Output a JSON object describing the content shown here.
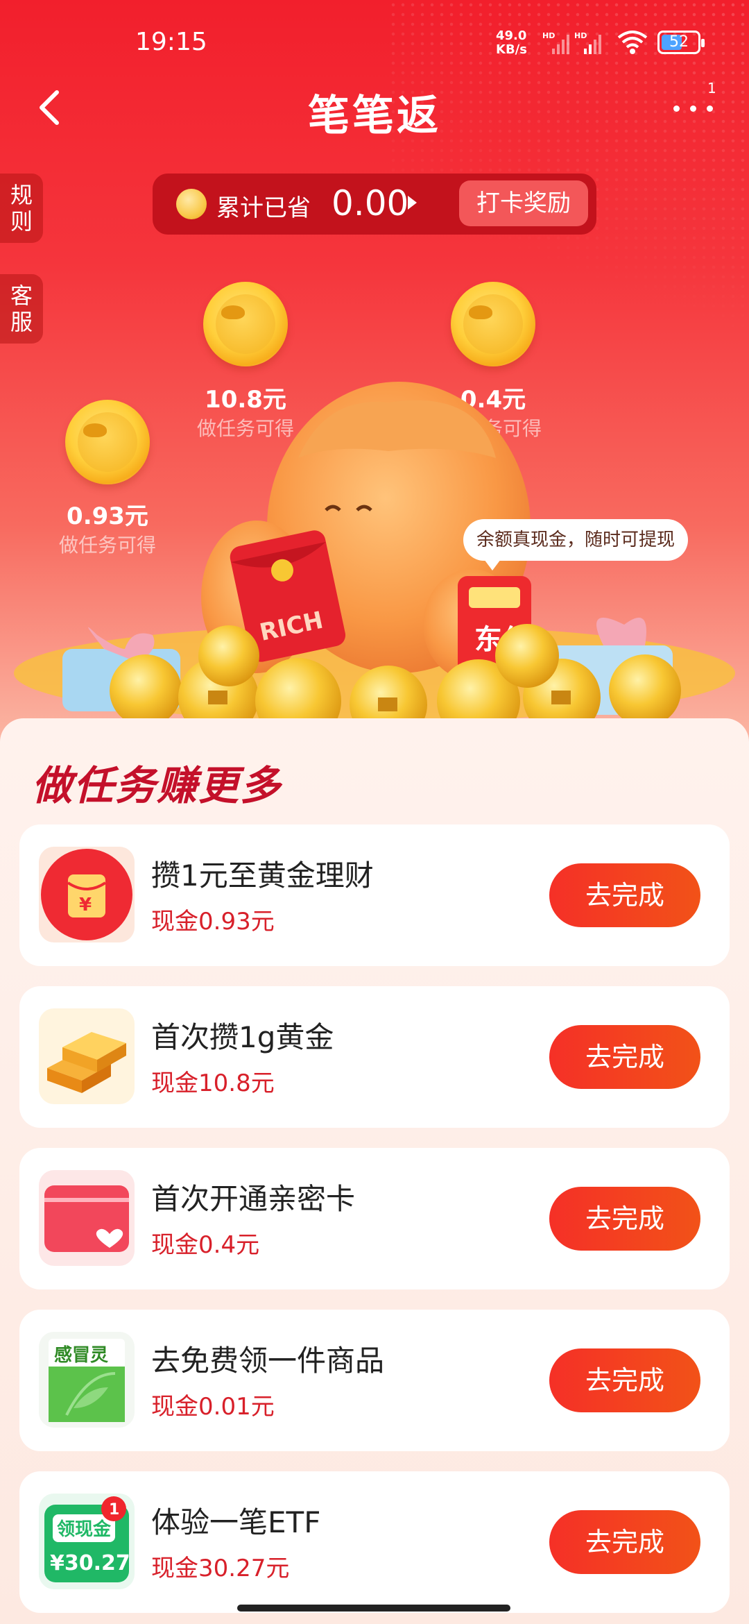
{
  "status_bar": {
    "time": "19:15",
    "speed": "49.0",
    "speed_unit": "KB/s",
    "hd": "HD",
    "battery": "52"
  },
  "nav": {
    "title": "笔笔返",
    "badge": "1"
  },
  "side_tabs": [
    {
      "label": "规\n则"
    },
    {
      "label": "客\n服"
    }
  ],
  "saved": {
    "label": "累计已省",
    "value": "0.00",
    "reward_button": "打卡奖励"
  },
  "coins": [
    {
      "amount": "10.8元",
      "sub": "做任务可得"
    },
    {
      "amount": "0.4元",
      "sub": "做任务可得"
    },
    {
      "amount": "0.93元",
      "sub": "做任务可得"
    }
  ],
  "bubble": "余额真现金，随时可提现",
  "mascot_text": {
    "bag": "RICH",
    "card": "东付"
  },
  "section_title": "做任务赚更多",
  "tasks": [
    {
      "name": "攒1元至黄金理财",
      "reward": "现金0.93元",
      "button": "去完成",
      "icon": "red-envelope-icon"
    },
    {
      "name": "首次攒1g黄金",
      "reward": "现金10.8元",
      "button": "去完成",
      "icon": "gold-bar-icon"
    },
    {
      "name": "首次开通亲密卡",
      "reward": "现金0.4元",
      "button": "去完成",
      "icon": "heart-card-icon"
    },
    {
      "name": "去免费领一件商品",
      "reward": "现金0.01元",
      "button": "去完成",
      "icon": "medicine-box-icon"
    },
    {
      "name": "体验一笔ETF",
      "reward": "现金30.27元",
      "button": "去完成",
      "icon": "cash-coupon-icon"
    }
  ],
  "task_icon_text": {
    "yuan": "¥",
    "medicine": "感冒灵",
    "coupon_title": "领现金",
    "coupon_value": "¥30.27",
    "coupon_badge": "1"
  },
  "colors": {
    "primary": "#f21f2c",
    "button": "#f53027",
    "reward_text": "#d8202a"
  }
}
